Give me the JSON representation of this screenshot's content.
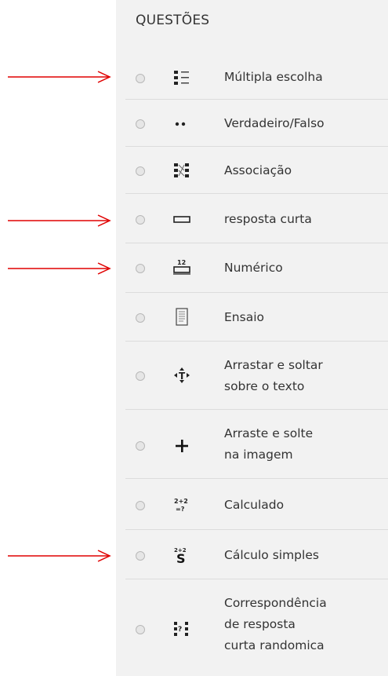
{
  "panel": {
    "title": "QUESTÕES",
    "items": [
      {
        "label": "Múltipla escolha",
        "icon": "multiple-choice-icon",
        "selected": false
      },
      {
        "label": "Verdadeiro/Falso",
        "icon": "true-false-icon",
        "selected": false
      },
      {
        "label": "Associação",
        "icon": "matching-icon",
        "selected": false
      },
      {
        "label": "resposta curta",
        "icon": "short-answer-icon",
        "selected": false
      },
      {
        "label": "Numérico",
        "icon": "numerical-icon",
        "selected": false
      },
      {
        "label": "Ensaio",
        "icon": "essay-icon",
        "selected": false
      },
      {
        "label": "Arrastar e soltar sobre o texto",
        "label_lines": [
          "Arrastar e soltar",
          "sobre o texto"
        ],
        "icon": "drag-drop-text-icon",
        "selected": false
      },
      {
        "label": "Arraste e solte na imagem",
        "label_lines": [
          "Arraste e solte",
          "na imagem"
        ],
        "icon": "drag-drop-image-icon",
        "selected": false
      },
      {
        "label": "Calculado",
        "icon": "calculated-icon",
        "selected": false
      },
      {
        "label": "Cálculo simples",
        "icon": "calculated-simple-icon",
        "selected": false
      },
      {
        "label": "Correspondência de resposta curta randomica",
        "label_lines": [
          "Correspondência",
          "de resposta",
          "curta randomica"
        ],
        "icon": "random-short-answer-matching-icon",
        "selected": false
      }
    ]
  },
  "annotations": {
    "arrow_color": "#e00000",
    "marked_items": [
      "Múltipla escolha",
      "resposta curta",
      "Numérico",
      "Cálculo simples"
    ]
  },
  "colors": {
    "panel_background": "#f2f2f2",
    "divider": "#dcdcdc",
    "text": "#333333",
    "icon": "#222222"
  }
}
